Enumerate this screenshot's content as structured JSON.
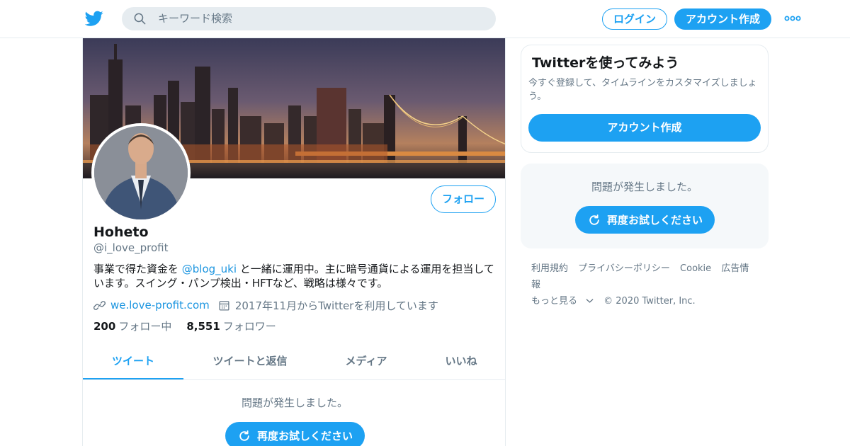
{
  "header": {
    "search_placeholder": "キーワード検索",
    "login_label": "ログイン",
    "signup_label": "アカウント作成",
    "icons": {
      "logo": "twitter-bird-icon",
      "search": "search-icon",
      "more": "more-dots-icon"
    }
  },
  "profile": {
    "follow_label": "フォロー",
    "name": "Hoheto",
    "handle": "@i_love_profit",
    "bio_part1": "事業で得た資金を ",
    "bio_mention": "@blog_uki",
    "bio_part2": " と一緒に運用中。主に暗号通貨による運用を担当しています。スイング・パンプ検出・HFTなど、戦略は様々です。",
    "website": "we.love-profit.com",
    "joined": "2017年11月からTwitterを利用しています",
    "following_count": "200",
    "following_label": "フォロー中",
    "followers_count": "8,551",
    "followers_label": "フォロワー"
  },
  "tabs": [
    "ツイート",
    "ツイートと返信",
    "メディア",
    "いいね"
  ],
  "timeline": {
    "error_text": "問題が発生しました。",
    "retry_label": "再度お試しください"
  },
  "sidebar": {
    "signup_card": {
      "title": "Twitterを使ってみよう",
      "description": "今すぐ登録して、タイムラインをカスタマイズしましょう。",
      "cta": "アカウント作成"
    },
    "error_card": {
      "error_text": "問題が発生しました。",
      "retry_label": "再度お試しください"
    },
    "footer": {
      "links": [
        "利用規約",
        "プライバシーポリシー",
        "Cookie",
        "広告情報"
      ],
      "more": "もっと見る",
      "copyright": "© 2020 Twitter, Inc."
    }
  },
  "colors": {
    "accent": "#1da1f2",
    "link": "#1b95e0",
    "muted": "#657786",
    "border": "#e6ecf0"
  }
}
